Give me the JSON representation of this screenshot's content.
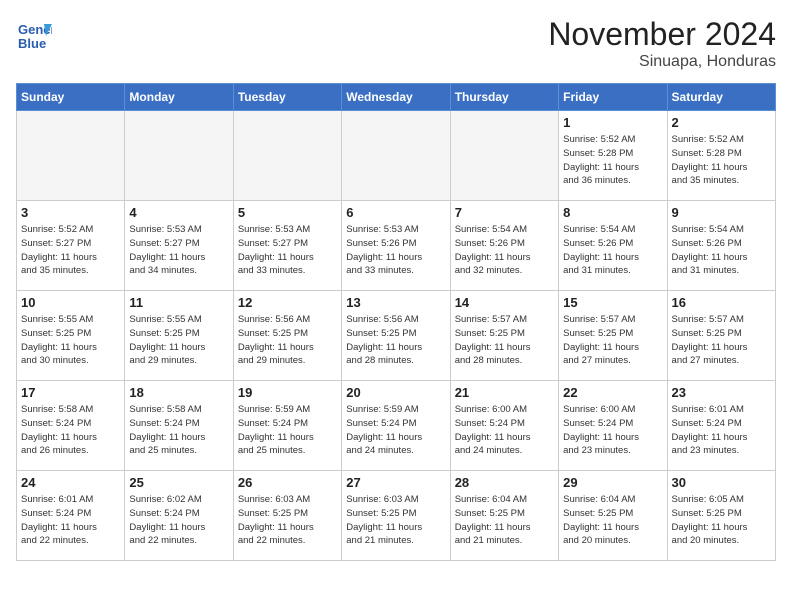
{
  "header": {
    "logo_line1": "General",
    "logo_line2": "Blue",
    "month": "November 2024",
    "location": "Sinuapa, Honduras"
  },
  "weekdays": [
    "Sunday",
    "Monday",
    "Tuesday",
    "Wednesday",
    "Thursday",
    "Friday",
    "Saturday"
  ],
  "weeks": [
    [
      {
        "day": "",
        "info": ""
      },
      {
        "day": "",
        "info": ""
      },
      {
        "day": "",
        "info": ""
      },
      {
        "day": "",
        "info": ""
      },
      {
        "day": "",
        "info": ""
      },
      {
        "day": "1",
        "info": "Sunrise: 5:52 AM\nSunset: 5:28 PM\nDaylight: 11 hours\nand 36 minutes."
      },
      {
        "day": "2",
        "info": "Sunrise: 5:52 AM\nSunset: 5:28 PM\nDaylight: 11 hours\nand 35 minutes."
      }
    ],
    [
      {
        "day": "3",
        "info": "Sunrise: 5:52 AM\nSunset: 5:27 PM\nDaylight: 11 hours\nand 35 minutes."
      },
      {
        "day": "4",
        "info": "Sunrise: 5:53 AM\nSunset: 5:27 PM\nDaylight: 11 hours\nand 34 minutes."
      },
      {
        "day": "5",
        "info": "Sunrise: 5:53 AM\nSunset: 5:27 PM\nDaylight: 11 hours\nand 33 minutes."
      },
      {
        "day": "6",
        "info": "Sunrise: 5:53 AM\nSunset: 5:26 PM\nDaylight: 11 hours\nand 33 minutes."
      },
      {
        "day": "7",
        "info": "Sunrise: 5:54 AM\nSunset: 5:26 PM\nDaylight: 11 hours\nand 32 minutes."
      },
      {
        "day": "8",
        "info": "Sunrise: 5:54 AM\nSunset: 5:26 PM\nDaylight: 11 hours\nand 31 minutes."
      },
      {
        "day": "9",
        "info": "Sunrise: 5:54 AM\nSunset: 5:26 PM\nDaylight: 11 hours\nand 31 minutes."
      }
    ],
    [
      {
        "day": "10",
        "info": "Sunrise: 5:55 AM\nSunset: 5:25 PM\nDaylight: 11 hours\nand 30 minutes."
      },
      {
        "day": "11",
        "info": "Sunrise: 5:55 AM\nSunset: 5:25 PM\nDaylight: 11 hours\nand 29 minutes."
      },
      {
        "day": "12",
        "info": "Sunrise: 5:56 AM\nSunset: 5:25 PM\nDaylight: 11 hours\nand 29 minutes."
      },
      {
        "day": "13",
        "info": "Sunrise: 5:56 AM\nSunset: 5:25 PM\nDaylight: 11 hours\nand 28 minutes."
      },
      {
        "day": "14",
        "info": "Sunrise: 5:57 AM\nSunset: 5:25 PM\nDaylight: 11 hours\nand 28 minutes."
      },
      {
        "day": "15",
        "info": "Sunrise: 5:57 AM\nSunset: 5:25 PM\nDaylight: 11 hours\nand 27 minutes."
      },
      {
        "day": "16",
        "info": "Sunrise: 5:57 AM\nSunset: 5:25 PM\nDaylight: 11 hours\nand 27 minutes."
      }
    ],
    [
      {
        "day": "17",
        "info": "Sunrise: 5:58 AM\nSunset: 5:24 PM\nDaylight: 11 hours\nand 26 minutes."
      },
      {
        "day": "18",
        "info": "Sunrise: 5:58 AM\nSunset: 5:24 PM\nDaylight: 11 hours\nand 25 minutes."
      },
      {
        "day": "19",
        "info": "Sunrise: 5:59 AM\nSunset: 5:24 PM\nDaylight: 11 hours\nand 25 minutes."
      },
      {
        "day": "20",
        "info": "Sunrise: 5:59 AM\nSunset: 5:24 PM\nDaylight: 11 hours\nand 24 minutes."
      },
      {
        "day": "21",
        "info": "Sunrise: 6:00 AM\nSunset: 5:24 PM\nDaylight: 11 hours\nand 24 minutes."
      },
      {
        "day": "22",
        "info": "Sunrise: 6:00 AM\nSunset: 5:24 PM\nDaylight: 11 hours\nand 23 minutes."
      },
      {
        "day": "23",
        "info": "Sunrise: 6:01 AM\nSunset: 5:24 PM\nDaylight: 11 hours\nand 23 minutes."
      }
    ],
    [
      {
        "day": "24",
        "info": "Sunrise: 6:01 AM\nSunset: 5:24 PM\nDaylight: 11 hours\nand 22 minutes."
      },
      {
        "day": "25",
        "info": "Sunrise: 6:02 AM\nSunset: 5:24 PM\nDaylight: 11 hours\nand 22 minutes."
      },
      {
        "day": "26",
        "info": "Sunrise: 6:03 AM\nSunset: 5:25 PM\nDaylight: 11 hours\nand 22 minutes."
      },
      {
        "day": "27",
        "info": "Sunrise: 6:03 AM\nSunset: 5:25 PM\nDaylight: 11 hours\nand 21 minutes."
      },
      {
        "day": "28",
        "info": "Sunrise: 6:04 AM\nSunset: 5:25 PM\nDaylight: 11 hours\nand 21 minutes."
      },
      {
        "day": "29",
        "info": "Sunrise: 6:04 AM\nSunset: 5:25 PM\nDaylight: 11 hours\nand 20 minutes."
      },
      {
        "day": "30",
        "info": "Sunrise: 6:05 AM\nSunset: 5:25 PM\nDaylight: 11 hours\nand 20 minutes."
      }
    ]
  ]
}
